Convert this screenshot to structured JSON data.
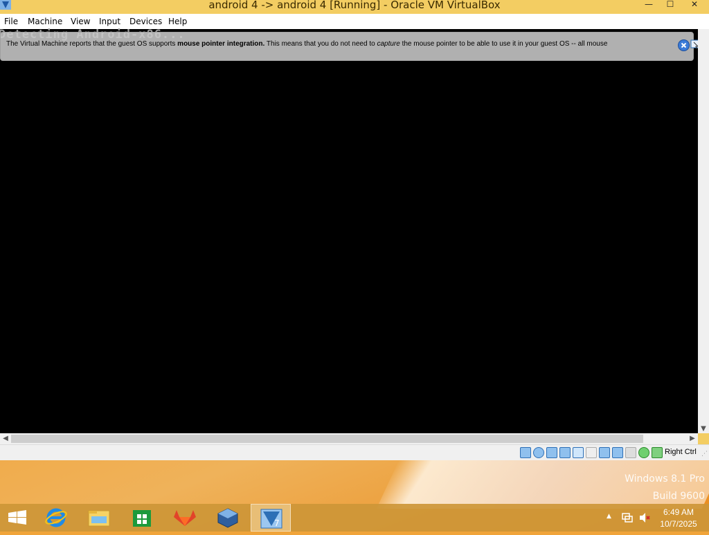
{
  "window": {
    "title": "android 4 -> android 4 [Running] - Oracle VM VirtualBox",
    "controls": {
      "minimize": "—",
      "maximize": "☐",
      "close": "✕"
    }
  },
  "menu": {
    "items": [
      "File",
      "Machine",
      "View",
      "Input",
      "Devices",
      "Help"
    ]
  },
  "vm": {
    "console_text": "Detecting Android-x86...",
    "notice": {
      "prefix": "The Virtual Machine reports that the guest OS supports ",
      "bold": "mouse pointer integration.",
      "middle": " This means that you do not need to ",
      "italic": "capture",
      "suffix": " the mouse pointer to be able to use it in your guest OS -- all mouse"
    }
  },
  "statusbar": {
    "host_key": "Right Ctrl",
    "icons": [
      "hard-disk-icon",
      "optical-drive-icon",
      "audio-icon",
      "network-icon",
      "usb-icon",
      "shared-folders-icon",
      "display-icon",
      "video-capture-icon",
      "virtualization-icon",
      "cpu-icon",
      "mouse-integration-icon",
      "keyboard-capture-icon"
    ]
  },
  "desktop": {
    "watermark_line1": "Windows 8.1 Pro",
    "watermark_line2": "Build 9600"
  },
  "taskbar": {
    "apps": [
      "start-icon",
      "internet-explorer-icon",
      "file-explorer-icon",
      "store-icon",
      "gitlab-icon",
      "virtualbox-icon",
      "virtualbox-vm-icon"
    ],
    "tray": {
      "time": "6:49 AM",
      "date": "10/7/2025"
    }
  },
  "colors": {
    "titlebar": "#f3cd62",
    "desktop_accent": "#f08a1e",
    "vm_screen": "#000000"
  }
}
